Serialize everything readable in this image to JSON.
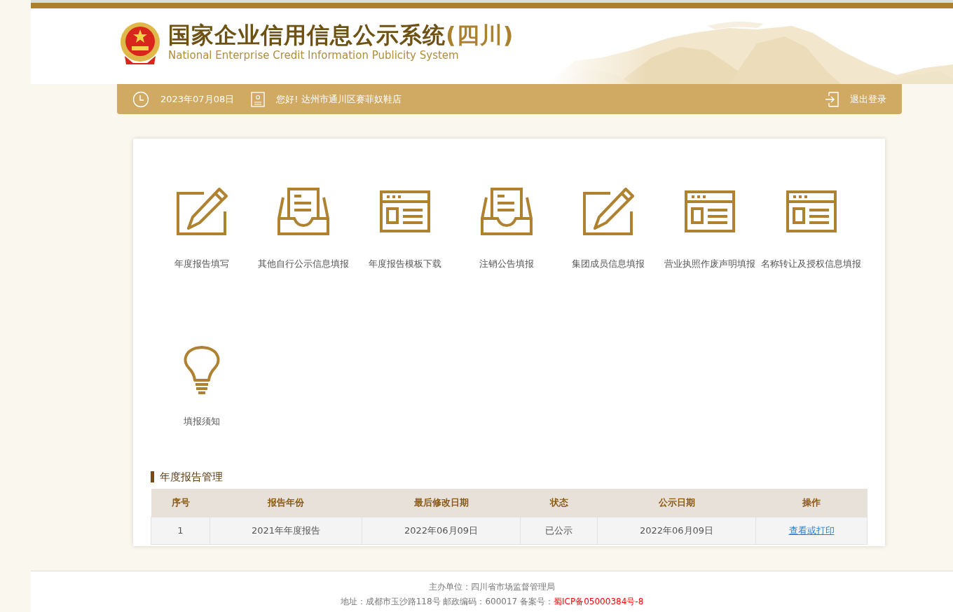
{
  "header": {
    "title": "国家企业信用信息公示系统",
    "region": "(四川)",
    "subtitle": "National Enterprise Credit Information Publicity System"
  },
  "info_bar": {
    "date": "2023年07月08日",
    "greeting": "您好! 达州市通川区赛菲奴鞋店",
    "logout": "退出登录"
  },
  "functions": [
    {
      "label": "年度报告填写",
      "kind": "edit"
    },
    {
      "label": "其他自行公示信息填报",
      "kind": "tray"
    },
    {
      "label": "年度报告模板下载",
      "kind": "window"
    },
    {
      "label": "注销公告填报",
      "kind": "tray"
    },
    {
      "label": "集团成员信息填报",
      "kind": "edit"
    },
    {
      "label": "营业执照作废声明填报",
      "kind": "window"
    },
    {
      "label": "名称转让及授权信息填报",
      "kind": "window"
    },
    {
      "label": "填报须知",
      "kind": "bulb"
    }
  ],
  "report_section": {
    "title": "年度报告管理",
    "table": {
      "columns": [
        "序号",
        "报告年份",
        "最后修改日期",
        "状态",
        "公示日期",
        "操作"
      ],
      "rows": [
        {
          "cells": [
            "1",
            "2021年年度报告",
            "2022年06月09日",
            "已公示",
            "2022年06月09日"
          ],
          "action": "查看或打印"
        }
      ]
    }
  },
  "footer": {
    "sponsor": "主办单位：四川省市场监督管理局",
    "address": "地址：成都市玉沙路118号 邮政编码：600017 备案号：",
    "icp": "蜀ICP备05000384号-8"
  }
}
